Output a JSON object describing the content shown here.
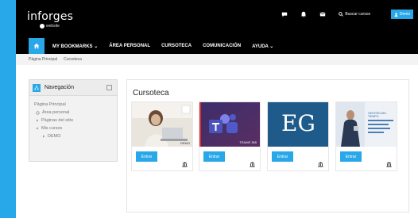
{
  "header": {
    "brand": "inforges",
    "brand_sub": "website",
    "search_label": "Buscar cursos",
    "user_label": "Demo"
  },
  "nav": {
    "items": [
      "MY BOOKMARKS ⌄",
      "ÁREA PERSONAL",
      "CURSOTECA",
      "COMUNICACIÓN",
      "AYUDA ⌄"
    ]
  },
  "breadcrumb": [
    "Página Principal",
    "Cursoteca"
  ],
  "sidebar": {
    "title": "Navegación",
    "items": [
      "Página Principal",
      "Área personal",
      "Páginas del sitio",
      "Mis cursos",
      "DEMO"
    ]
  },
  "main": {
    "title": "Cursoteca",
    "courses": [
      {
        "thumb": "woman-laptop",
        "caption": "DEMO",
        "button": "Entrar"
      },
      {
        "thumb": "teams",
        "caption": "TEAMS 365",
        "button": "Entrar"
      },
      {
        "thumb": "eg",
        "caption": "EG",
        "button": "Entrar"
      },
      {
        "thumb": "businessman",
        "caption": "GESTIÓN DEL TIEMPO",
        "button": "Entrar"
      }
    ]
  },
  "colors": {
    "accent": "#28a8e8",
    "header": "#000000"
  }
}
